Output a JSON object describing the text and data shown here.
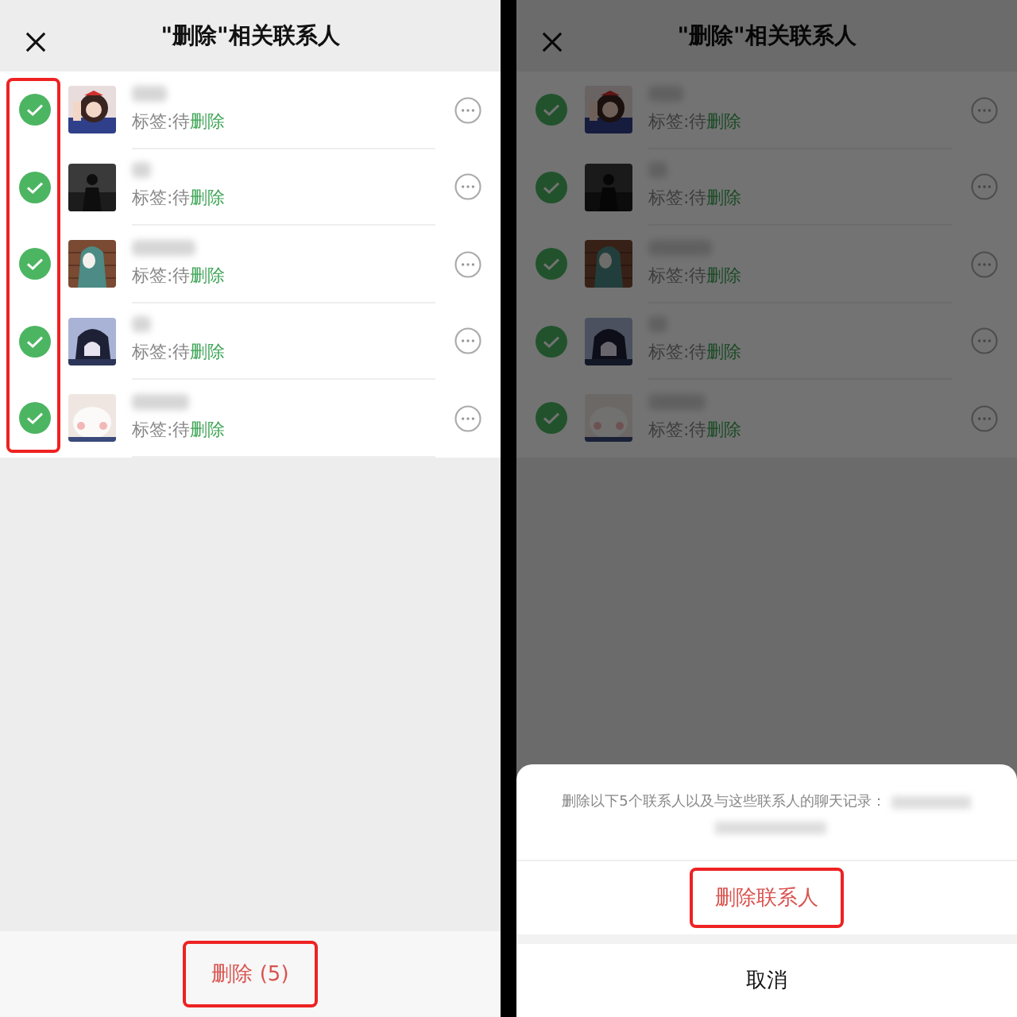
{
  "screens": [
    {
      "title": "\"删除\"相关联系人",
      "dimmed": false,
      "checks_highlighted": true,
      "contacts": [
        {
          "tag_prefix": "标签:待",
          "tag": "删除",
          "checked": true
        },
        {
          "tag_prefix": "标签:待",
          "tag": "删除",
          "checked": true
        },
        {
          "tag_prefix": "标签:待",
          "tag": "删除",
          "checked": true
        },
        {
          "tag_prefix": "标签:待",
          "tag": "删除",
          "checked": true
        },
        {
          "tag_prefix": "标签:待",
          "tag": "删除",
          "checked": true
        }
      ],
      "footer_button": {
        "label": "删除 (5)",
        "highlighted": true
      }
    },
    {
      "title": "\"删除\"相关联系人",
      "dimmed": true,
      "checks_highlighted": false,
      "contacts": [
        {
          "tag_prefix": "标签:待",
          "tag": "删除",
          "checked": true
        },
        {
          "tag_prefix": "标签:待",
          "tag": "删除",
          "checked": true
        },
        {
          "tag_prefix": "标签:待",
          "tag": "删除",
          "checked": true
        },
        {
          "tag_prefix": "标签:待",
          "tag": "删除",
          "checked": true
        },
        {
          "tag_prefix": "标签:待",
          "tag": "删除",
          "checked": true
        }
      ],
      "sheet": {
        "message": "删除以下5个联系人以及与这些联系人的聊天记录：",
        "confirm": {
          "label": "删除联系人",
          "highlighted": true
        },
        "cancel": "取消"
      }
    }
  ]
}
